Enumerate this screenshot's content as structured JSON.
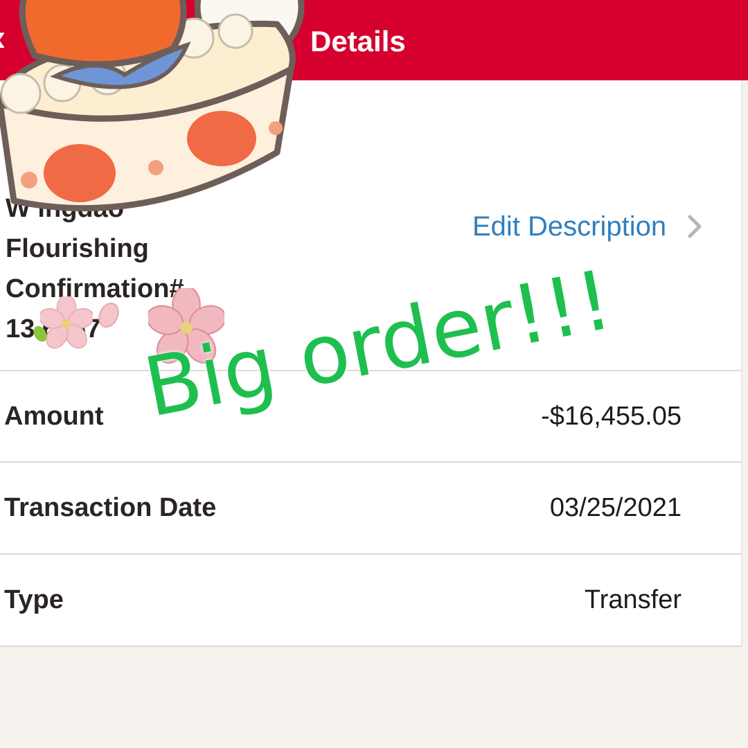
{
  "header": {
    "title": "Details",
    "back_icon": "chevron-left-icon",
    "background": "#d6002f"
  },
  "description": {
    "line1": "W             ingdao",
    "line2": "Flourishing",
    "line3": "Confirmation#",
    "line4": "13     6167",
    "edit_label": "Edit Description",
    "edit_icon": "chevron-right-icon"
  },
  "rows": [
    {
      "label": "Amount",
      "value": "-$16,455.05"
    },
    {
      "label": "Transaction Date",
      "value": "03/25/2021"
    },
    {
      "label": "Type",
      "value": "Transfer"
    }
  ],
  "overlay": {
    "text": "Big order!!!",
    "color": "#1fbf4f"
  },
  "stickers": [
    "cake-sticker",
    "cherry-blossom-sticker"
  ],
  "colors": {
    "accent_link": "#2f7fc0",
    "page_background": "#f6f3ef"
  }
}
